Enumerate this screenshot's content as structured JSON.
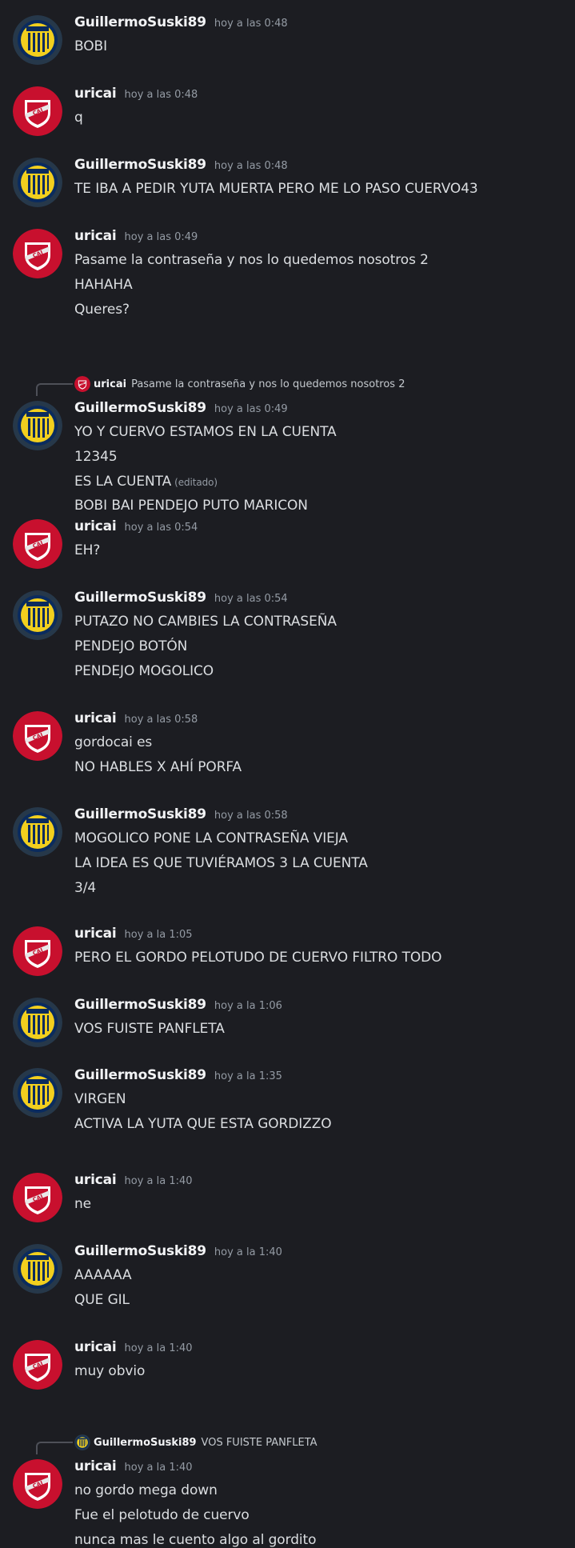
{
  "colors": {
    "background": "#1c1d22",
    "username": "#f2f3f5",
    "message_text": "#dbdee1",
    "timestamp": "#949ba4",
    "rosario_yellow": "#f2cf1e",
    "rosario_blue": "#0a2b5e",
    "independiente_red": "#c8102e"
  },
  "icons": {
    "guillermo_avatar": "rosario-central-crest-icon",
    "uricai_avatar": "independiente-crest-icon"
  },
  "messages": [
    {
      "user": "GuillermoSuski89",
      "avatar": "rosario",
      "time": "hoy a las 0:48",
      "lines": [
        "BOBI"
      ]
    },
    {
      "user": "uricai",
      "avatar": "independiente",
      "time": "hoy a las 0:48",
      "lines": [
        "q"
      ]
    },
    {
      "user": "GuillermoSuski89",
      "avatar": "rosario",
      "time": "hoy a las 0:48",
      "lines": [
        "TE IBA A PEDIR YUTA MUERTA PERO ME LO PASO CUERVO43"
      ]
    },
    {
      "user": "uricai",
      "avatar": "independiente",
      "time": "hoy a las 0:49",
      "lines": [
        "Pasame la contraseña y nos lo quedemos nosotros 2",
        "HAHAHA",
        "Queres?"
      ]
    },
    {
      "user": "GuillermoSuski89",
      "avatar": "rosario",
      "time": "hoy a las 0:49",
      "reply": {
        "user": "uricai",
        "avatar": "independiente",
        "text": "Pasame la contraseña y nos lo quedemos nosotros 2"
      },
      "lines": [
        "YO Y CUERVO ESTAMOS EN LA CUENTA",
        "12345",
        "ES LA CUENTA",
        "BOBI BAI PENDEJO PUTO MARICON"
      ],
      "edited_label": "(editado)"
    },
    {
      "user": "uricai",
      "avatar": "independiente",
      "time": "hoy a las 0:54",
      "lines": [
        "EH?"
      ]
    },
    {
      "user": "GuillermoSuski89",
      "avatar": "rosario",
      "time": "hoy a las 0:54",
      "lines": [
        "PUTAZO NO CAMBIES LA CONTRASEÑA",
        "PENDEJO BOTÓN",
        "PENDEJO MOGOLICO"
      ]
    },
    {
      "user": "uricai",
      "avatar": "independiente",
      "time": "hoy a las 0:58",
      "lines": [
        "gordocai es",
        "NO HABLES X AHÍ PORFA"
      ]
    },
    {
      "user": "GuillermoSuski89",
      "avatar": "rosario",
      "time": "hoy a las 0:58",
      "lines": [
        "MOGOLICO PONE LA CONTRASEÑA VIEJA",
        "LA IDEA ES QUE TUVIÉRAMOS 3 LA CUENTA",
        "3/4"
      ]
    },
    {
      "user": "uricai",
      "avatar": "independiente",
      "time": "hoy a la 1:05",
      "lines": [
        "PERO EL GORDO PELOTUDO DE CUERVO FILTRO TODO"
      ]
    },
    {
      "user": "GuillermoSuski89",
      "avatar": "rosario",
      "time": "hoy a la 1:06",
      "lines": [
        "VOS FUISTE PANFLETA"
      ]
    },
    {
      "user": "GuillermoSuski89",
      "avatar": "rosario",
      "time": "hoy a la 1:35",
      "lines": [
        "VIRGEN",
        "ACTIVA LA YUTA QUE ESTA GORDIZZO"
      ]
    },
    {
      "user": "uricai",
      "avatar": "independiente",
      "time": "hoy a la 1:40",
      "lines": [
        "ne"
      ]
    },
    {
      "user": "GuillermoSuski89",
      "avatar": "rosario",
      "time": "hoy a la 1:40",
      "lines": [
        "AAAAAA",
        "QUE GIL"
      ]
    },
    {
      "user": "uricai",
      "avatar": "independiente",
      "time": "hoy a la 1:40",
      "lines": [
        "muy obvio"
      ]
    },
    {
      "user": "uricai",
      "avatar": "independiente",
      "time": "hoy a la 1:40",
      "reply": {
        "user": "GuillermoSuski89",
        "avatar": "rosario",
        "text": "VOS FUISTE PANFLETA"
      },
      "lines": [
        "no gordo mega down",
        "Fue el pelotudo de cuervo",
        "nunca mas le cuento algo al gordito"
      ]
    }
  ]
}
